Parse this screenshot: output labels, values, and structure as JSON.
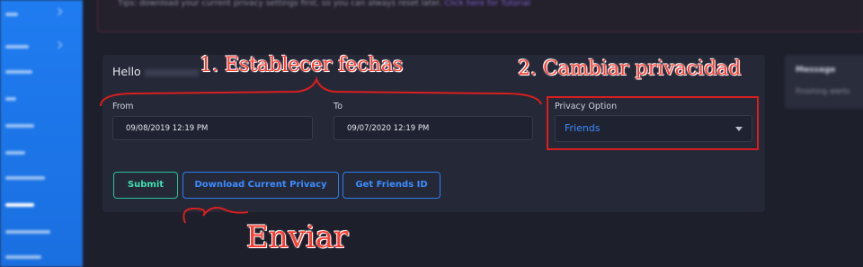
{
  "top_banner": {
    "tip_text": "Tips: download your current privacy settings first, so you can always reset later.",
    "tip_link": "Click here for Tutorial"
  },
  "card": {
    "greeting": "Hello",
    "from_label": "From",
    "from_value": "09/08/2019 12:19 PM",
    "to_label": "To",
    "to_value": "09/07/2020 12:19 PM",
    "privacy_label": "Privacy Option",
    "privacy_value": "Friends",
    "buttons": {
      "submit": "Submit",
      "download": "Download Current Privacy",
      "friends": "Get Friends ID"
    }
  },
  "side_card": {
    "title": "Message",
    "text": "Finishing alerts"
  },
  "annotations": {
    "step1": "1. Establecer fechas",
    "step2": "2. Cambiar privacidad",
    "send": "Enviar",
    "color": "#ff3b2f"
  },
  "colors": {
    "sidebar": "#1f7cf0",
    "accent_blue": "#3d8cff",
    "accent_green": "#3ee0b0",
    "annotation_red": "#d91f1f"
  }
}
